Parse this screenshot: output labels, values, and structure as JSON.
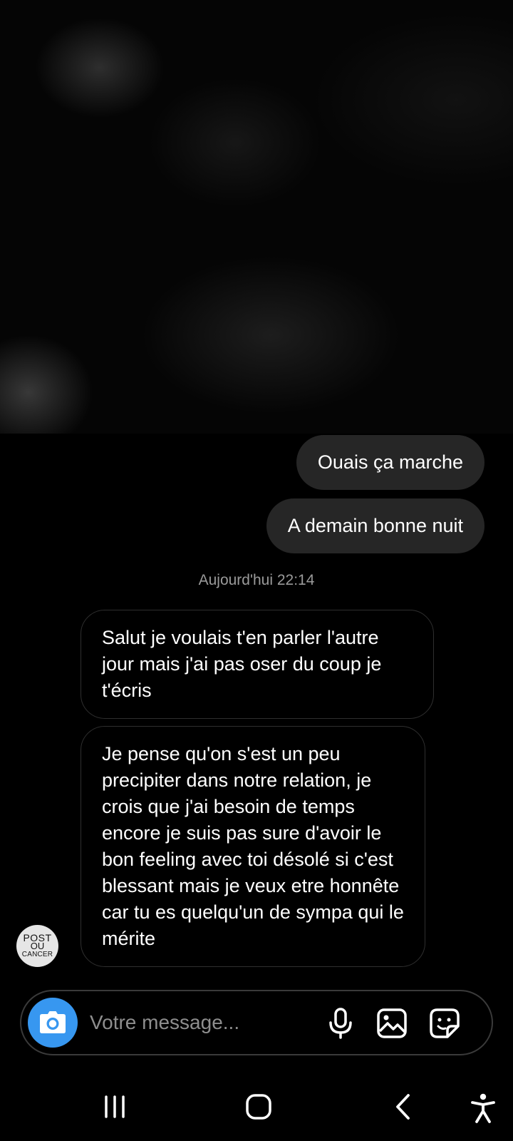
{
  "messages": {
    "sent": [
      "Ouais ça marche",
      "A demain bonne nuit"
    ],
    "timestamp": "Aujourd'hui 22:14",
    "received": [
      "Salut je voulais t'en parler l'autre jour mais j'ai pas oser du coup je t'écris",
      "Je pense qu'on s'est un peu precipiter dans notre relation, je crois que j'ai besoin de temps encore je suis pas sure d'avoir le bon feeling avec toi désolé si c'est blessant mais je veux etre honnête car tu es quelqu'un de sympa qui le mérite"
    ]
  },
  "avatar": {
    "line1": "POST",
    "line2": "OU",
    "line3": "CANCER"
  },
  "composer": {
    "placeholder": "Votre message...",
    "accent_color": "#3797f0",
    "icons": [
      "camera-icon",
      "microphone-icon",
      "gallery-icon",
      "sticker-icon"
    ]
  },
  "navbar": {
    "icons": [
      "recent-apps-icon",
      "home-icon",
      "back-icon",
      "accessibility-icon"
    ]
  }
}
